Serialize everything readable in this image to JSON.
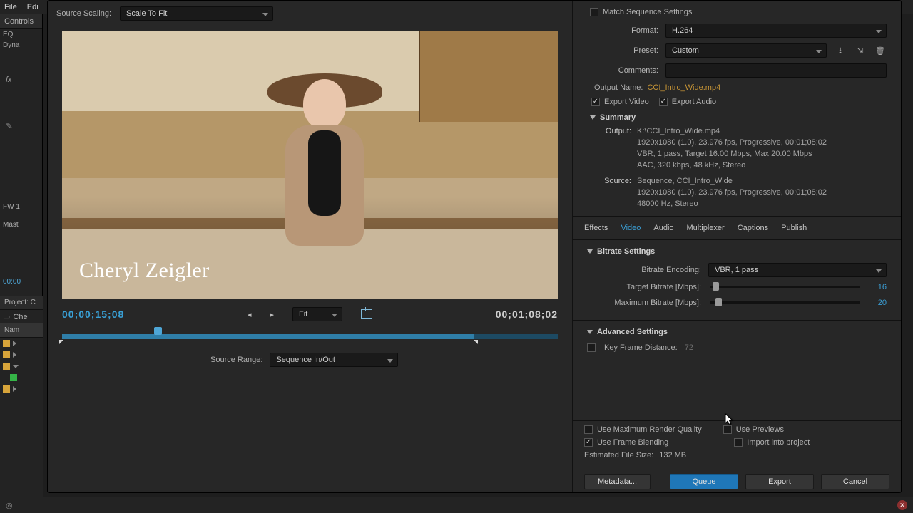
{
  "menubar": {
    "file": "File",
    "edit": "Edi"
  },
  "left_dock": {
    "controls_tab": "Controls",
    "fx": [
      "EQ",
      "Dyna"
    ],
    "fw": "FW 1",
    "master": "Mast",
    "small_tc": "00:00",
    "project_label": "Project: C",
    "search": "Che",
    "name_hdr": "Nam"
  },
  "source_scaling": {
    "label": "Source Scaling:",
    "value": "Scale To Fit"
  },
  "preview": {
    "lower_third": "Cheryl Zeigler"
  },
  "playback": {
    "current": "00;00;15;08",
    "fit": "Fit",
    "duration": "00;01;08;02"
  },
  "source_range": {
    "label": "Source Range:",
    "value": "Sequence In/Out"
  },
  "export": {
    "match_seq": "Match Sequence Settings",
    "format_label": "Format:",
    "format_value": "H.264",
    "preset_label": "Preset:",
    "preset_value": "Custom",
    "comments_label": "Comments:",
    "output_name_label": "Output Name:",
    "output_name": "CCI_Intro_Wide.mp4",
    "export_video": "Export Video",
    "export_audio": "Export Audio"
  },
  "summary": {
    "title": "Summary",
    "output_label": "Output:",
    "output_lines": [
      "K:\\CCI_Intro_Wide.mp4",
      "1920x1080 (1.0), 23.976 fps, Progressive, 00;01;08;02",
      "VBR, 1 pass, Target 16.00 Mbps, Max 20.00 Mbps",
      "AAC, 320 kbps, 48 kHz, Stereo"
    ],
    "source_label": "Source:",
    "source_lines": [
      "Sequence, CCI_Intro_Wide",
      "1920x1080 (1.0), 23.976 fps, Progressive, 00;01;08;02",
      "48000 Hz, Stereo"
    ]
  },
  "tabs": {
    "effects": "Effects",
    "video": "Video",
    "audio": "Audio",
    "multiplexer": "Multiplexer",
    "captions": "Captions",
    "publish": "Publish"
  },
  "bitrate": {
    "title": "Bitrate Settings",
    "encoding_label": "Bitrate Encoding:",
    "encoding_value": "VBR, 1 pass",
    "target_label": "Target Bitrate [Mbps]:",
    "target_value": "16",
    "max_label": "Maximum Bitrate [Mbps]:",
    "max_value": "20"
  },
  "advanced": {
    "title": "Advanced Settings",
    "keyframe_label": "Key Frame Distance:",
    "keyframe_value": "72"
  },
  "options": {
    "max_quality": "Use Maximum Render Quality",
    "previews": "Use Previews",
    "frame_blend": "Use Frame Blending",
    "import_proj": "Import into project",
    "est_label": "Estimated File Size:",
    "est_value": "132 MB"
  },
  "buttons": {
    "metadata": "Metadata...",
    "queue": "Queue",
    "export": "Export",
    "cancel": "Cancel"
  }
}
